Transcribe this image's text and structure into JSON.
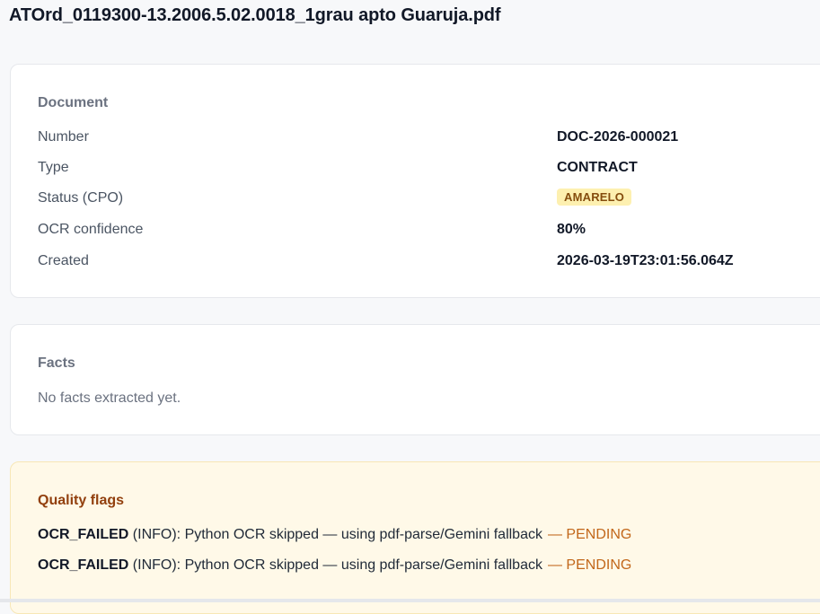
{
  "header": {
    "title": "ATOrd_0119300-13.2006.5.02.0018_1grau apto Guaruja.pdf"
  },
  "document": {
    "section_title": "Document",
    "fields": [
      {
        "label": "Number",
        "value": "DOC-2026-000021"
      },
      {
        "label": "Type",
        "value": "CONTRACT"
      },
      {
        "label": "Status (CPO)",
        "value": "AMARELO"
      },
      {
        "label": "OCR confidence",
        "value": "80%"
      },
      {
        "label": "Created",
        "value": "2026-03-19T23:01:56.064Z"
      }
    ],
    "status_badge_color": "#fdf0b0"
  },
  "facts": {
    "section_title": "Facts",
    "empty_message": "No facts extracted yet."
  },
  "quality_flags": {
    "section_title": "Quality flags",
    "items": [
      {
        "code": "OCR_FAILED",
        "level": " (INFO): ",
        "message": "Python OCR skipped — using pdf-parse/Gemini fallback",
        "status": "— PENDING"
      },
      {
        "code": "OCR_FAILED",
        "level": " (INFO): ",
        "message": "Python OCR skipped — using pdf-parse/Gemini fallback",
        "status": "— PENDING"
      }
    ],
    "background_color": "#fff9e8",
    "status_color": "#c2671a"
  }
}
